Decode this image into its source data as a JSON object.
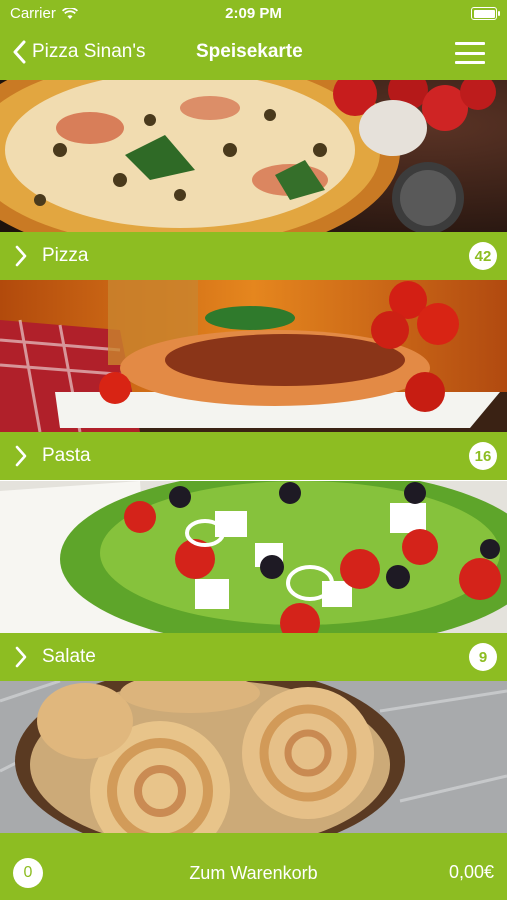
{
  "status_bar": {
    "carrier": "Carrier",
    "time": "2:09 PM"
  },
  "nav": {
    "back_label": "Pizza Sinan's",
    "title": "Speisekarte"
  },
  "categories": [
    {
      "name": "Pizza",
      "count": "42",
      "image_icon": "pizza-photo"
    },
    {
      "name": "Pasta",
      "count": "16",
      "image_icon": "pasta-photo"
    },
    {
      "name": "Salate",
      "count": "9",
      "image_icon": "salad-photo"
    },
    {
      "name": "",
      "count": "",
      "image_icon": "rolls-photo"
    }
  ],
  "cart": {
    "count": "0",
    "label": "Zum Warenkorb",
    "total": "0,00€"
  },
  "colors": {
    "accent": "#8dbd22",
    "text": "#ffffff"
  }
}
